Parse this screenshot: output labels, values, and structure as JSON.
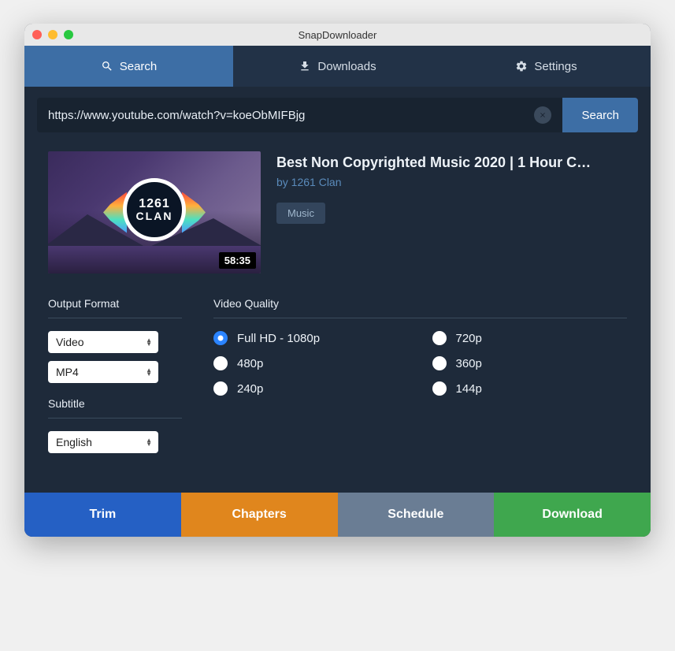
{
  "window": {
    "title": "SnapDownloader"
  },
  "tabs": {
    "search": "Search",
    "downloads": "Downloads",
    "settings": "Settings"
  },
  "searchbar": {
    "url": "https://www.youtube.com/watch?v=koeObMIFBjg",
    "button": "Search"
  },
  "video": {
    "title": "Best Non Copyrighted Music 2020 | 1 Hour C…",
    "author": "by 1261 Clan",
    "category": "Music",
    "duration": "58:35",
    "logo_line1": "1261",
    "logo_line2": "CLAN"
  },
  "labels": {
    "output_format": "Output Format",
    "video_quality": "Video Quality",
    "subtitle": "Subtitle"
  },
  "selects": {
    "format_type": "Video",
    "container": "MP4",
    "subtitle": "English"
  },
  "quality": {
    "q0": "Full HD - 1080p",
    "q1": "720p",
    "q2": "480p",
    "q3": "360p",
    "q4": "240p",
    "q5": "144p"
  },
  "bottom": {
    "trim": "Trim",
    "chapters": "Chapters",
    "schedule": "Schedule",
    "download": "Download"
  }
}
